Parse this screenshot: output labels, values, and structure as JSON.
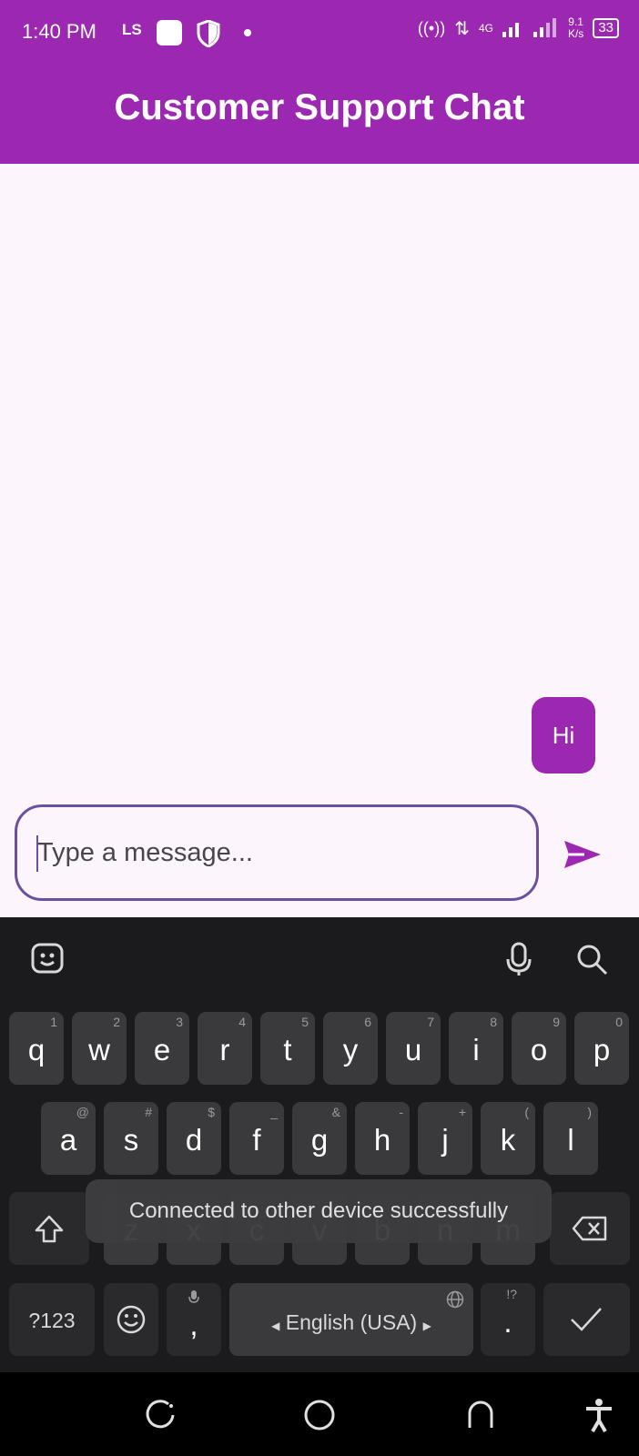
{
  "status_bar": {
    "time": "1:40 PM",
    "carrier_badge": "LS",
    "network": "4G",
    "speed_value": "9.1",
    "speed_unit": "K/s",
    "battery": "33"
  },
  "app_bar": {
    "title": "Customer Support Chat"
  },
  "messages": [
    {
      "text": "Hi",
      "sender": "user"
    }
  ],
  "composer": {
    "placeholder": "Type a message...",
    "send_icon": "send-icon"
  },
  "keyboard": {
    "row1": [
      {
        "k": "q",
        "h": "1"
      },
      {
        "k": "w",
        "h": "2"
      },
      {
        "k": "e",
        "h": "3"
      },
      {
        "k": "r",
        "h": "4"
      },
      {
        "k": "t",
        "h": "5"
      },
      {
        "k": "y",
        "h": "6"
      },
      {
        "k": "u",
        "h": "7"
      },
      {
        "k": "i",
        "h": "8"
      },
      {
        "k": "o",
        "h": "9"
      },
      {
        "k": "p",
        "h": "0"
      }
    ],
    "row2": [
      {
        "k": "a",
        "h": "@"
      },
      {
        "k": "s",
        "h": "#"
      },
      {
        "k": "d",
        "h": "$"
      },
      {
        "k": "f",
        "h": "_"
      },
      {
        "k": "g",
        "h": "&"
      },
      {
        "k": "h",
        "h": "-"
      },
      {
        "k": "j",
        "h": "+"
      },
      {
        "k": "k",
        "h": "("
      },
      {
        "k": "l",
        "h": ")"
      }
    ],
    "row3": [
      {
        "k": "z",
        "h": ""
      },
      {
        "k": "x",
        "h": ""
      },
      {
        "k": "c",
        "h": ""
      },
      {
        "k": "v",
        "h": ""
      },
      {
        "k": "b",
        "h": ""
      },
      {
        "k": "n",
        "h": ""
      },
      {
        "k": "m",
        "h": ""
      }
    ],
    "symbols_key": "?123",
    "comma": ",",
    "space_label": "English (USA)",
    "period": ".",
    "period_hint": "!?"
  },
  "toast": {
    "text": "Connected to other device successfully"
  },
  "colors": {
    "primary": "#9c27b0",
    "outline": "#6b4fa0",
    "background": "#fdf5fc",
    "keyboard": "#1b1b1d"
  }
}
